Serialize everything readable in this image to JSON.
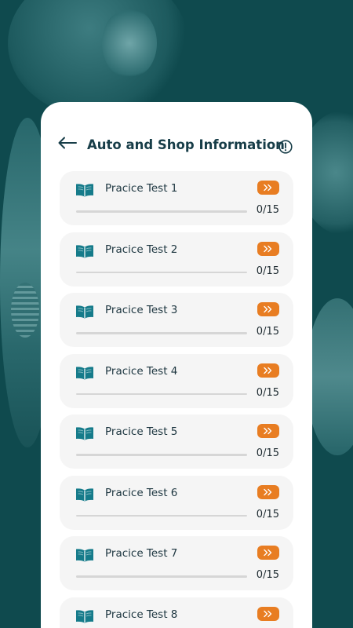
{
  "header": {
    "title": "Auto and Shop Information",
    "back_icon": "arrow-left-icon",
    "info_icon": "info-circle-icon"
  },
  "colors": {
    "accent": "#e87d22",
    "title": "#173d48",
    "background": "#0f4a4e",
    "card": "#ffffff",
    "item_bg": "#f5f5f5"
  },
  "tests": [
    {
      "label": "Pracice Test 1",
      "score": "0/15",
      "progress": 0
    },
    {
      "label": "Pracice Test 2",
      "score": "0/15",
      "progress": 0
    },
    {
      "label": "Pracice Test 3",
      "score": "0/15",
      "progress": 0
    },
    {
      "label": "Pracice Test 4",
      "score": "0/15",
      "progress": 0
    },
    {
      "label": "Pracice Test 5",
      "score": "0/15",
      "progress": 0
    },
    {
      "label": "Pracice Test 6",
      "score": "0/15",
      "progress": 0
    },
    {
      "label": "Pracice Test 7",
      "score": "0/15",
      "progress": 0
    },
    {
      "label": "Pracice Test 8",
      "score": "",
      "progress": 0
    }
  ]
}
